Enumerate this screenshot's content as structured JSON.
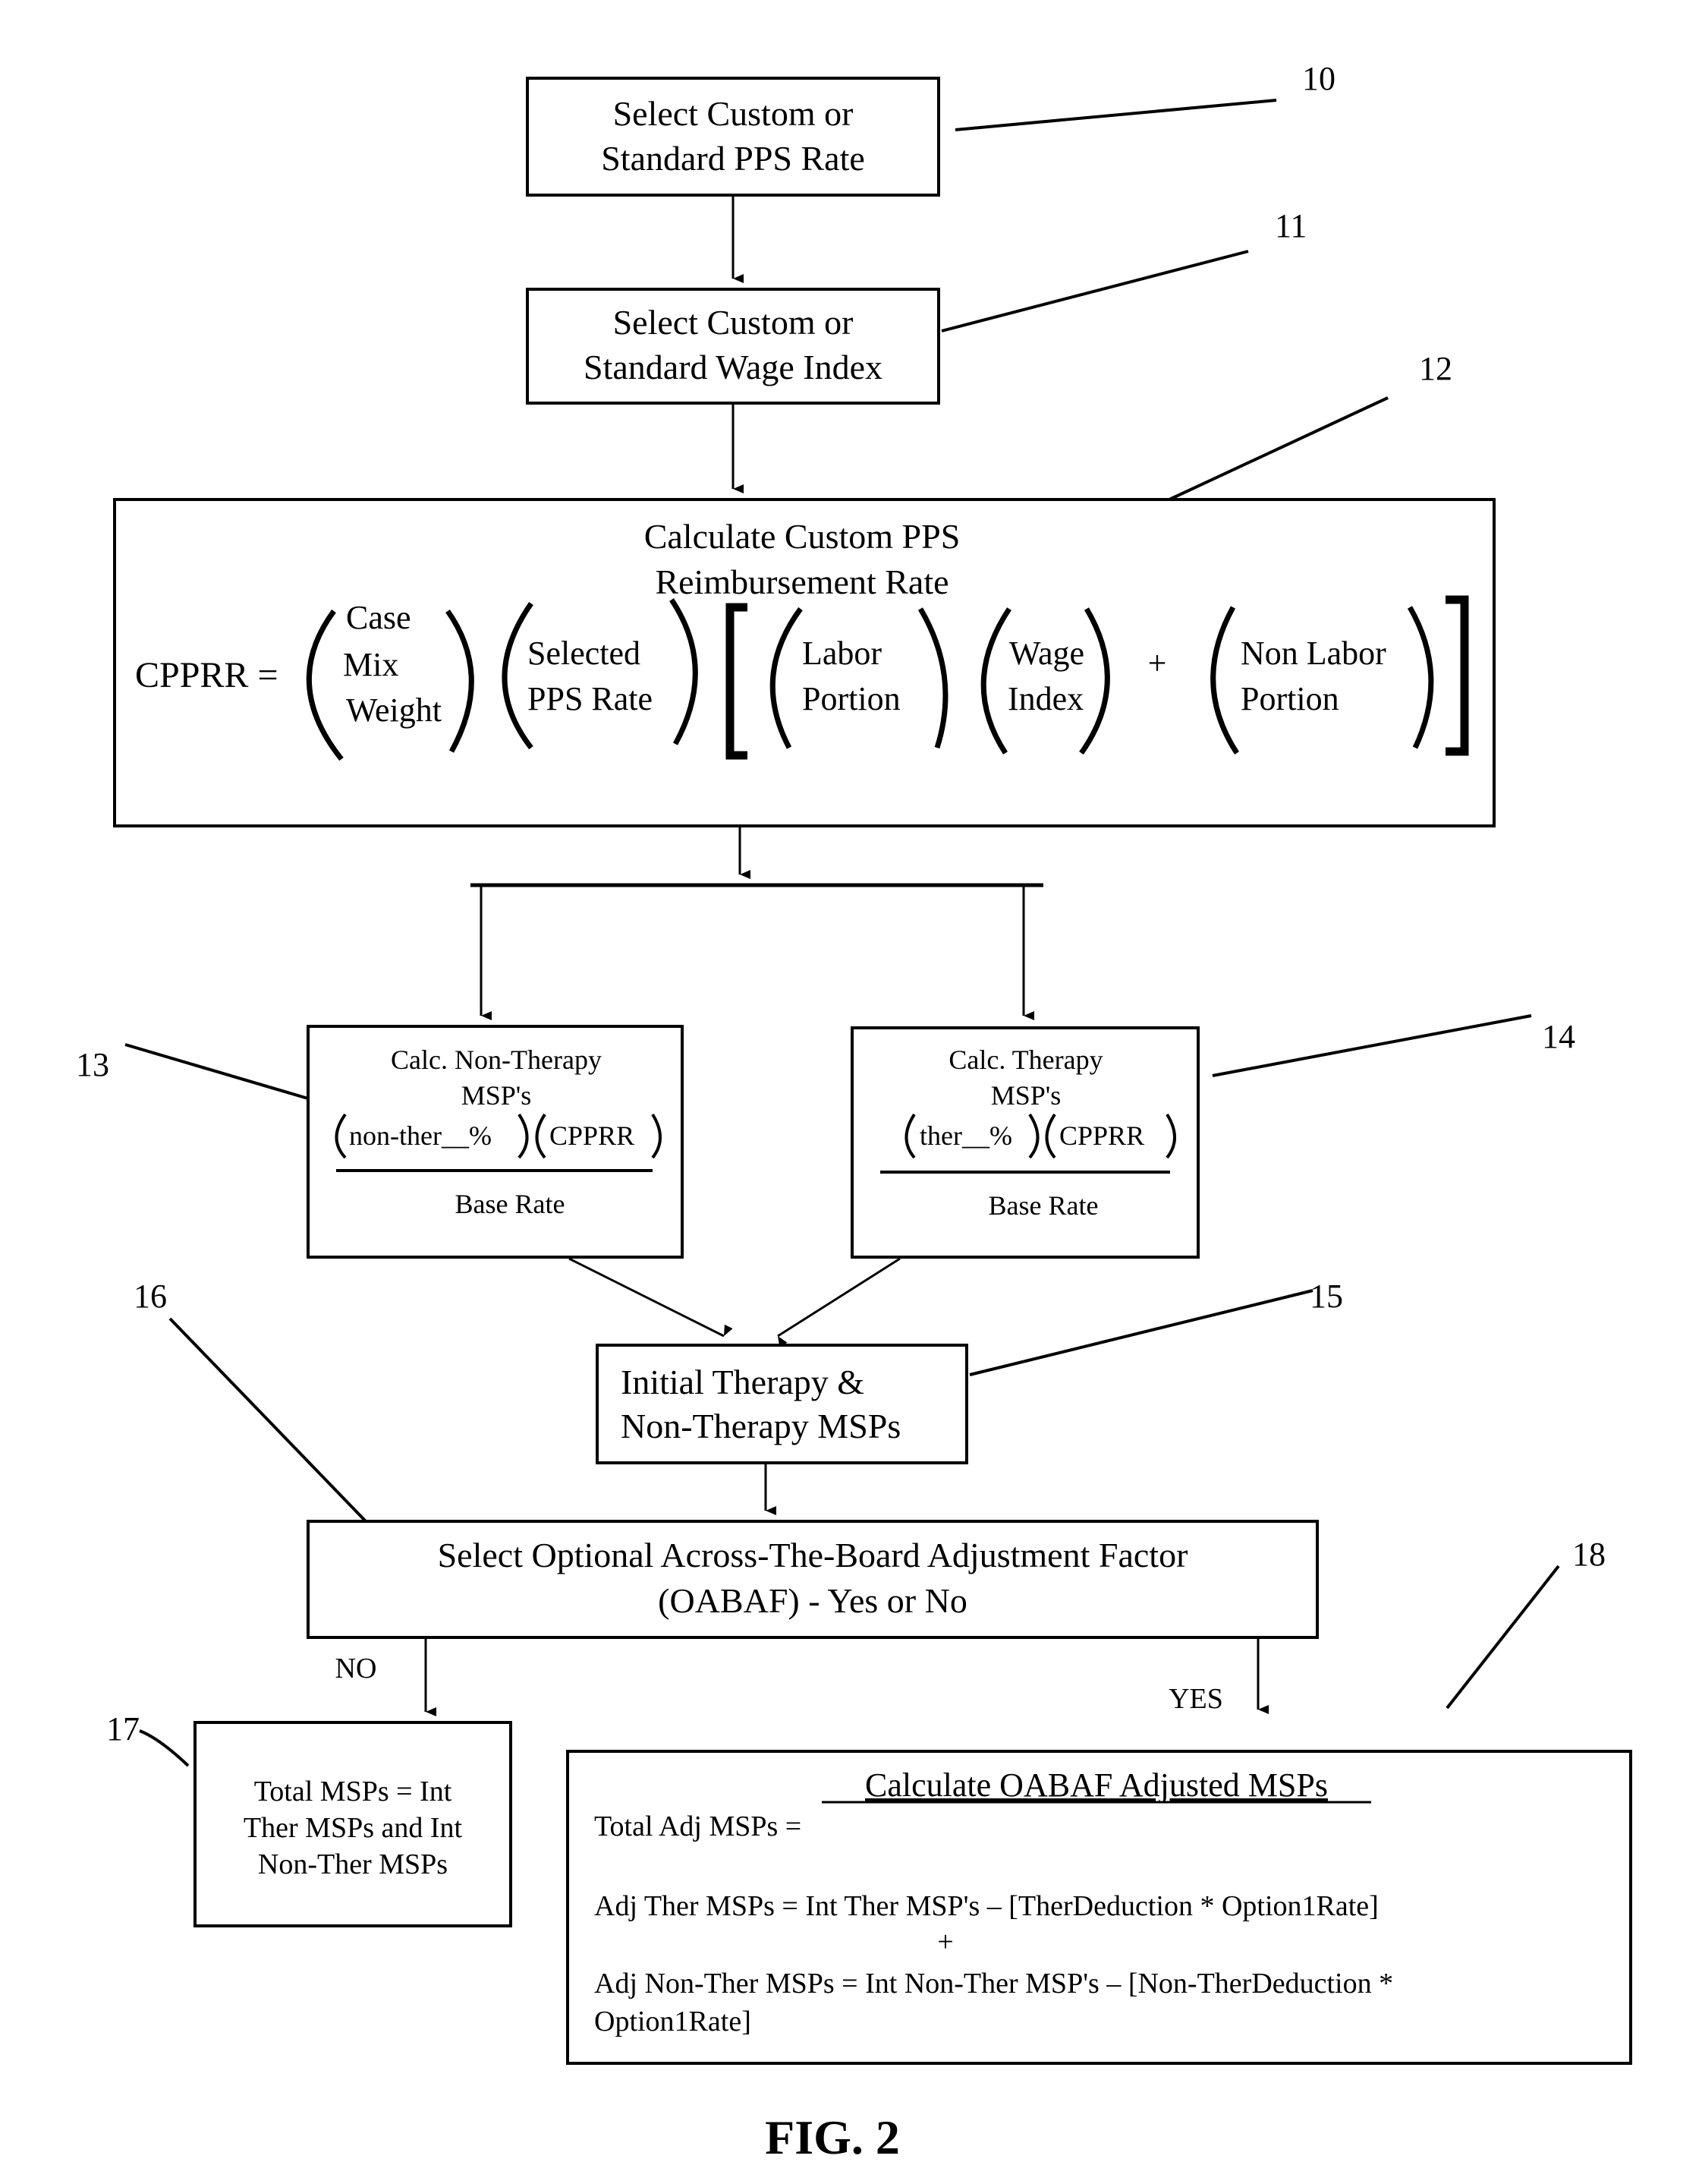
{
  "figure": {
    "caption": "FIG. 2",
    "type": "flowchart"
  },
  "nodes": {
    "n10": {
      "ref": "10",
      "lines": [
        "Select Custom or",
        "Standard PPS Rate"
      ]
    },
    "n11": {
      "ref": "11",
      "lines": [
        "Select Custom or",
        "Standard Wage Index"
      ]
    },
    "n12": {
      "ref": "12",
      "title_lines": [
        "Calculate Custom PPS",
        "Reimbursement Rate"
      ],
      "formula": {
        "lhs": "CPPRR =",
        "factor1": [
          "Case",
          "Mix",
          "Weight"
        ],
        "factor2": [
          "Selected",
          "PPS Rate"
        ],
        "factor3": [
          "Labor",
          "Portion"
        ],
        "factor4": [
          "Wage",
          "Index"
        ],
        "plus": "+",
        "factor5": [
          "Non Labor",
          "Portion"
        ]
      }
    },
    "n13": {
      "ref": "13",
      "lines": [
        "Calc. Non-Therapy",
        "MSP's"
      ],
      "numerator_a": "non-ther__%",
      "numerator_b": "CPPRR",
      "denominator": "Base Rate"
    },
    "n14": {
      "ref": "14",
      "lines": [
        "Calc. Therapy",
        "MSP's"
      ],
      "numerator_a": "ther__%",
      "numerator_b": "CPPRR",
      "denominator": "Base Rate"
    },
    "n15": {
      "ref": "15",
      "lines": [
        "Initial Therapy &",
        "Non-Therapy MSPs"
      ]
    },
    "n16": {
      "ref": "16",
      "lines": [
        "Select Optional Across-The-Board Adjustment Factor",
        "(OABAF) - Yes or No"
      ]
    },
    "n17": {
      "ref": "17",
      "lines": [
        "Total MSPs = Int",
        "Ther MSPs and Int",
        "Non-Ther MSPs"
      ]
    },
    "n18": {
      "ref": "18",
      "title": "Calculate OABAF Adjusted MSPs",
      "lines": [
        "Total Adj MSPs =",
        "Adj Ther MSPs  = Int Ther MSP's – [TherDeduction *  Option1Rate]",
        "+",
        "Adj Non-Ther MSPs  =  Int Non-Ther MSP's – [Non-TherDeduction *",
        "Option1Rate]"
      ]
    }
  },
  "edges": {
    "no_label": "NO",
    "yes_label": "YES"
  }
}
